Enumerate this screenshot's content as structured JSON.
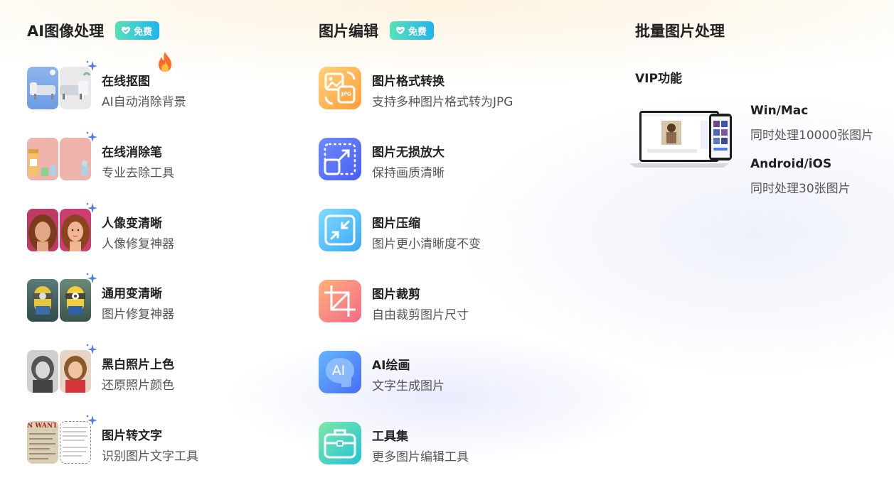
{
  "col1": {
    "title": "AI图像处理",
    "badge": "免费",
    "items": [
      {
        "title": "在线抠图",
        "desc": "AI自动消除背景"
      },
      {
        "title": "在线消除笔",
        "desc": "专业去除工具"
      },
      {
        "title": "人像变清晰",
        "desc": "人像修复神器"
      },
      {
        "title": "通用变清晰",
        "desc": "图片修复神器"
      },
      {
        "title": "黑白照片上色",
        "desc": "还原照片颜色"
      },
      {
        "title": "图片转文字",
        "desc": "识别图片文字工具"
      }
    ]
  },
  "col2": {
    "title": "图片编辑",
    "badge": "免费",
    "items": [
      {
        "title": "图片格式转换",
        "desc": "支持多种图片格式转为JPG",
        "icon_text": "JPG"
      },
      {
        "title": "图片无损放大",
        "desc": "保持画质清晰"
      },
      {
        "title": "图片压缩",
        "desc": "图片更小清晰度不变"
      },
      {
        "title": "图片裁剪",
        "desc": "自由裁剪图片尺寸"
      },
      {
        "title": "AI绘画",
        "desc": "文字生成图片",
        "icon_text": "AI"
      },
      {
        "title": "工具集",
        "desc": "更多图片编辑工具"
      }
    ]
  },
  "col3": {
    "title": "批量图片处理",
    "vip": "VIP功能",
    "platforms": [
      {
        "title": "Win/Mac",
        "desc": "同时处理10000张图片"
      },
      {
        "title": "Android/iOS",
        "desc": "同时处理30张图片"
      }
    ]
  },
  "thumb_text": {
    "wanted": "N WANTI"
  },
  "colors": {
    "badge_from": "#58e0b7",
    "badge_to": "#20b5ee",
    "title": "#222222",
    "desc": "#555555",
    "sparkle": "#4f7ce8"
  }
}
